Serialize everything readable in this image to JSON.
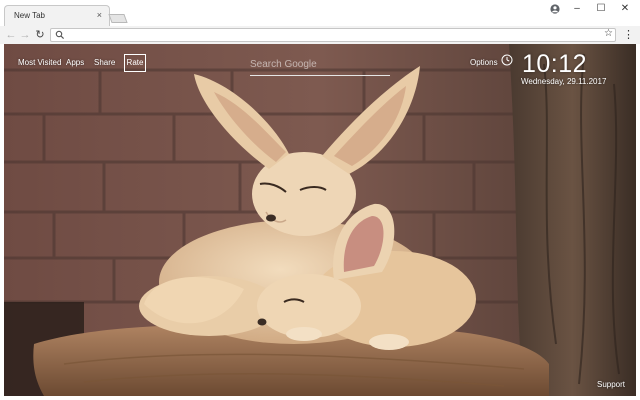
{
  "browser": {
    "tab": {
      "title": "New Tab",
      "close_glyph": "×"
    },
    "window_controls": {
      "minimize": "–",
      "maximize": "☐",
      "close": "✕"
    },
    "nav": {
      "back": "←",
      "forward": "→",
      "reload": "↻"
    },
    "address_bar": {
      "value": "",
      "placeholder": ""
    },
    "icons": [
      "profile-icon",
      "search-icon",
      "star-icon",
      "menu-icon"
    ]
  },
  "ntp": {
    "nav_links": {
      "most_visited": "Most Visited",
      "apps": "Apps",
      "share": "Share",
      "rate": "Rate"
    },
    "search": {
      "placeholder": "Search Google"
    },
    "options": "Options",
    "clock": {
      "time": "10:12",
      "date": "Wednesday, 29.11.2017"
    },
    "support": "Support",
    "wallpaper": "fennec-foxes-wallpaper"
  },
  "colors": {
    "chrome_bg": "#f2f2f2",
    "ntp_text": "#ffffff",
    "brick": "#8d6055",
    "fur": "#e4c39d"
  }
}
